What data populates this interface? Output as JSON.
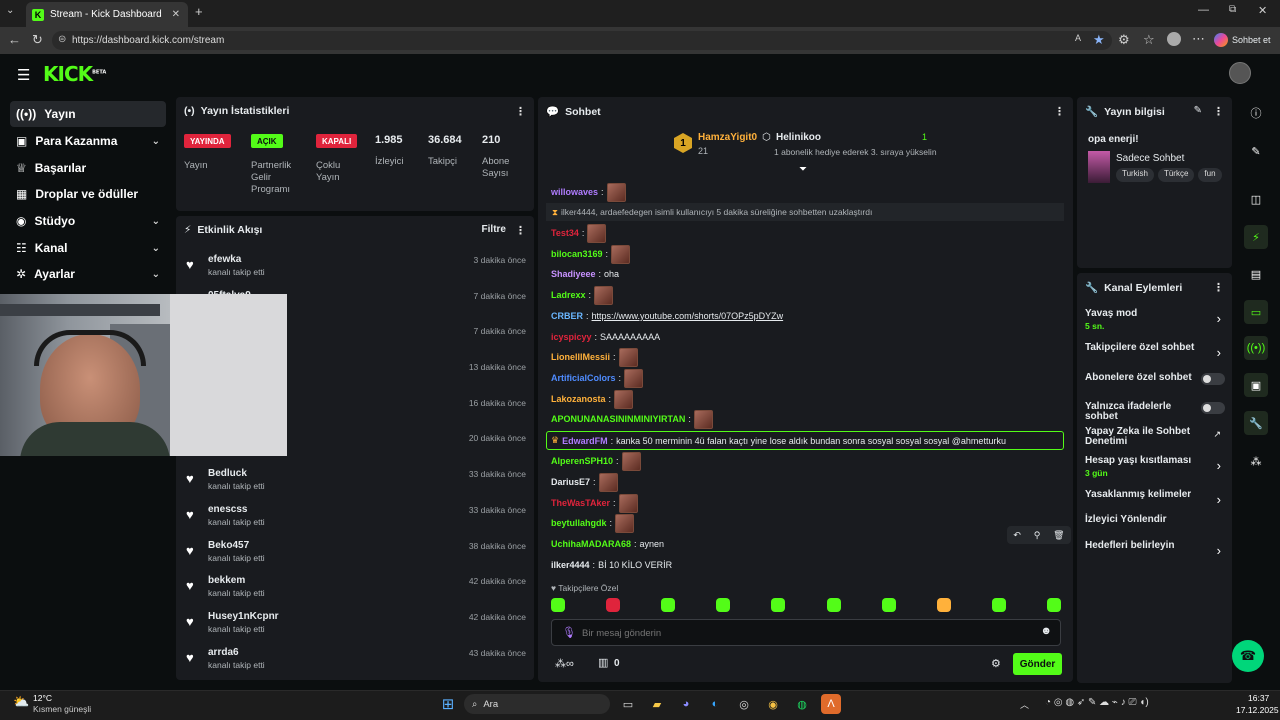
{
  "browser": {
    "tab_title": "Stream - Kick Dashboard",
    "url": "https://dashboard.kick.com/stream",
    "chat_label": "Sohbet et"
  },
  "brand": {
    "logo": "KICK",
    "beta": "BETA",
    "accent": "#53fc18"
  },
  "sidebar": {
    "items": [
      {
        "label": "Yayın",
        "icon": "broadcast-icon",
        "chevron": false
      },
      {
        "label": "Para Kazanma",
        "icon": "wallet-icon",
        "chevron": true
      },
      {
        "label": "Başarılar",
        "icon": "trophy-icon",
        "chevron": false
      },
      {
        "label": "Droplar ve ödüller",
        "icon": "gift-icon",
        "chevron": false
      },
      {
        "label": "Stüdyo",
        "icon": "studio-icon",
        "chevron": true
      },
      {
        "label": "Kanal",
        "icon": "users-icon",
        "chevron": true
      },
      {
        "label": "Ayarlar",
        "icon": "gear-icon",
        "chevron": true
      }
    ]
  },
  "stats": {
    "title": "Yayın İstatistikleri",
    "badges": [
      {
        "badge": "YAYINDA",
        "label": "Yayın",
        "color": "#e0243c"
      },
      {
        "badge": "AÇIK",
        "label": "Partnerlik Gelir Programı",
        "color": "#53fc18"
      },
      {
        "badge": "KAPALI",
        "label": "Çoklu Yayın",
        "color": "#e0243c"
      }
    ],
    "numbers": [
      {
        "value": "1.985",
        "label": "İzleyici"
      },
      {
        "value": "36.684",
        "label": "Takipçi"
      },
      {
        "value": "210",
        "label": "Abone Sayısı"
      }
    ]
  },
  "activity": {
    "title": "Etkinlik Akışı",
    "filter": "Filtre",
    "rows": [
      {
        "name": "efewka",
        "sub": "kanalı takip etti",
        "time": "3 dakika önce"
      },
      {
        "name": "05ftalva9",
        "sub": "",
        "time": "7 dakika önce"
      },
      {
        "name": "",
        "sub": "",
        "time": "7 dakika önce"
      },
      {
        "name": "",
        "sub": "",
        "time": "13 dakika önce"
      },
      {
        "name": "",
        "sub": "",
        "time": "16 dakika önce"
      },
      {
        "name": "",
        "sub": "",
        "time": "20 dakika önce"
      },
      {
        "name": "Bedluck",
        "sub": "kanalı takip etti",
        "time": "33 dakika önce"
      },
      {
        "name": "enescss",
        "sub": "kanalı takip etti",
        "time": "33 dakika önce"
      },
      {
        "name": "Beko457",
        "sub": "kanalı takip etti",
        "time": "38 dakika önce"
      },
      {
        "name": "bekkem",
        "sub": "kanalı takip etti",
        "time": "42 dakika önce"
      },
      {
        "name": "Husey1nKcpnr",
        "sub": "kanalı takip etti",
        "time": "42 dakika önce"
      },
      {
        "name": "arrda6",
        "sub": "kanalı takip etti",
        "time": "43 dakika önce"
      }
    ]
  },
  "chat": {
    "title": "Sohbet",
    "pinned": {
      "rank": "1",
      "user": "HamzaYigit0",
      "count": "21",
      "gifter": "Helinikoo",
      "gift_count": "1",
      "gift_text": "1 abonelik hediye ederek 3. sıraya yükselin"
    },
    "messages": [
      {
        "user": "willowaves",
        "color": "#b07cff",
        "text": "",
        "emote": true
      },
      {
        "system": true,
        "text": "ilker4444, ardaefedegen isimli kullanıcıyı 5 dakika süreliğine sohbetten uzaklaştırdı"
      },
      {
        "user": "Test34",
        "color": "#e0243c",
        "text": "",
        "emote": true
      },
      {
        "user": "bilocan3169",
        "color": "#53fc18",
        "text": "",
        "emote": true
      },
      {
        "user": "Shadiyeee",
        "color": "#c792ff",
        "text": "oha",
        "emote": false
      },
      {
        "user": "Ladrexx",
        "color": "#53fc18",
        "text": "",
        "emote": true
      },
      {
        "user": "CRBER",
        "color": "#6ab7ff",
        "text": "https://www.youtube.com/shorts/07OPz5pDYZw",
        "emote": false
      },
      {
        "user": "icyspicyy",
        "color": "#e0243c",
        "text": "SAAAAAAAAA",
        "emote": false
      },
      {
        "user": "LionelllMessii",
        "color": "#ffb13b",
        "text": "",
        "emote": true
      },
      {
        "user": "ArtificialColors",
        "color": "#4f8cff",
        "text": "",
        "emote": true
      },
      {
        "user": "Lakozanosta",
        "color": "#ffb13b",
        "text": "",
        "emote": true
      },
      {
        "user": "APONUNANASININMINIYIRTAN",
        "color": "#53fc18",
        "text": "",
        "emote": true
      },
      {
        "user": "EdwardFM",
        "color": "#b07cff",
        "text": "kanka 50 merminin 4ü falan kaçtı yine lose aldık bundan sonra sosyal sosyal sosyal @ahmetturku",
        "highlight": true
      },
      {
        "user": "AlperenSPH10",
        "color": "#53fc18",
        "text": "",
        "emote": true
      },
      {
        "user": "DariusE7",
        "color": "#e7ebee",
        "text": "",
        "emote": true
      },
      {
        "user": "TheWasTAker",
        "color": "#e0243c",
        "text": "",
        "emote": true
      },
      {
        "user": "beytullahgdk",
        "color": "#53fc18",
        "text": "",
        "emote": true
      },
      {
        "user": "UchihaMADARA68",
        "color": "#53fc18",
        "text": "aynen",
        "emote": false
      },
      {
        "user": "ilker4444",
        "color": "#e7ebee",
        "text": "Bİ 10 KİLO VERİR",
        "emote": false
      }
    ],
    "followers_only": "Takipçilere Özel",
    "input_placeholder": "Bir mesaj gönderin",
    "points": "0",
    "send": "Gönder"
  },
  "stream_info": {
    "title": "Yayın bilgisi",
    "stream_title": "opa enerji!",
    "category": "Sadece Sohbet",
    "tags": [
      "Turkish",
      "Türkçe",
      "fun"
    ]
  },
  "channel_actions": {
    "title": "Kanal Eylemleri",
    "items": [
      {
        "label": "Yavaş mod",
        "sub": "5 sn.",
        "control": "chevron"
      },
      {
        "label": "Takipçilere özel sohbet",
        "sub": "",
        "control": "chevron"
      },
      {
        "label": "Abonelere özel sohbet",
        "sub": "",
        "control": "toggle"
      },
      {
        "label": "Yalnızca ifadelerle sohbet",
        "sub": "",
        "control": "toggle"
      },
      {
        "label": "Yapay Zeka ile Sohbet Denetimi",
        "sub": "",
        "control": "external"
      },
      {
        "label": "Hesap yaşı kısıtlaması",
        "sub": "3 gün",
        "control": "chevron"
      },
      {
        "label": "Yasaklanmış kelimeler",
        "sub": "",
        "control": "chevron"
      },
      {
        "label": "İzleyici Yönlendir",
        "sub": "",
        "control": "none"
      },
      {
        "label": "Hedefleri belirleyin",
        "sub": "",
        "control": "chevron"
      }
    ]
  },
  "taskbar": {
    "weather_temp": "12°C",
    "weather_text": "Kısmen güneşli",
    "search": "Ara",
    "time": "16:37",
    "date": "17.12.2025"
  }
}
